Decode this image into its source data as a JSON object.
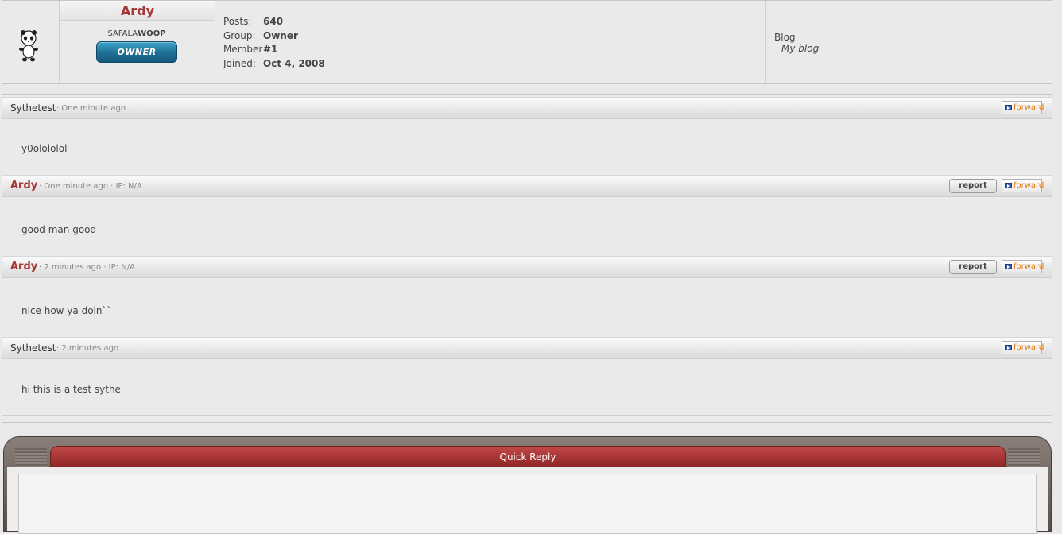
{
  "profile": {
    "username": "Ardy",
    "user_title_prefix": "SAFALA",
    "user_title_suffix": "WOOP",
    "rank": "OWNER",
    "stats": [
      {
        "label": "Posts:",
        "value": "640"
      },
      {
        "label": "Group:",
        "value": "Owner"
      },
      {
        "label": "Member",
        "value": "#1"
      },
      {
        "label": "Joined:",
        "value": "Oct 4, 2008"
      }
    ],
    "blog": {
      "title": "Blog",
      "link": "My blog"
    }
  },
  "comments": [
    {
      "author": "Sythetest",
      "is_owner": false,
      "meta": "· One minute ago",
      "body": "y0olololol",
      "has_report": false
    },
    {
      "author": "Ardy",
      "is_owner": true,
      "meta": "· One minute ago · IP: N/A",
      "body": "good man good",
      "has_report": true
    },
    {
      "author": "Ardy",
      "is_owner": true,
      "meta": "· 2 minutes ago · IP: N/A",
      "body": "nice how ya doin``",
      "has_report": true
    },
    {
      "author": "Sythetest",
      "is_owner": false,
      "meta": "· 2 minutes ago",
      "body": "hi this is a test sythe",
      "has_report": false
    }
  ],
  "buttons": {
    "report": "report",
    "forward": "forward"
  },
  "quick_reply": {
    "title": "Quick Reply",
    "textarea_value": ""
  },
  "colors": {
    "owner_name": "#a33535",
    "forward_text": "#e07a12",
    "rank_badge": "#1f6f95",
    "quick_reply_tab": "#a33232"
  },
  "icons": {
    "avatar": "panda-avatar",
    "forward": "forward-arrow-icon"
  }
}
